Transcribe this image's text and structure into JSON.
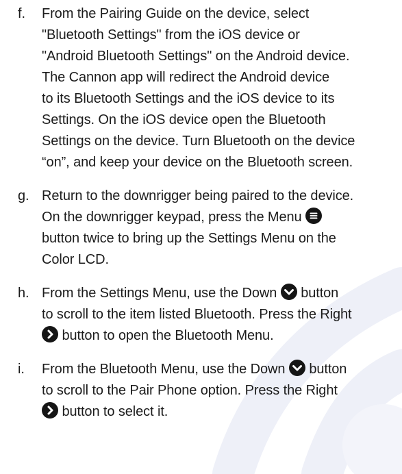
{
  "steps": [
    {
      "letter": "f.",
      "lines": [
        "From the Pairing Guide on the device, select",
        "\"Bluetooth Settings\" from the iOS device or",
        "\"Android Bluetooth Settings\" on the Android device.",
        "The Cannon app will redirect the Android device",
        "to its Bluetooth Settings and the iOS device to its",
        "Settings. On the iOS device open the Bluetooth",
        "Settings on the device. Turn Bluetooth on the device",
        "“on”, and keep your device on the Bluetooth screen."
      ]
    },
    {
      "letter": "g.",
      "line1": "Return to the downrigger being paired to the device.",
      "line2": "On the downrigger keypad, press the Menu",
      "line3": "button twice to bring up the Settings Menu on the",
      "line4": "Color LCD."
    },
    {
      "letter": "h.",
      "line1a": "From the Settings Menu, use the Down",
      "line1b": "button",
      "line2": "to scroll to the item listed Bluetooth. Press the Right",
      "line3": "button to open the Bluetooth Menu."
    },
    {
      "letter": "i.",
      "line1a": "From the Bluetooth Menu, use the Down",
      "line1b": "button",
      "line2": "to scroll to the Pair Phone option. Press the Right",
      "line3": "button to select it."
    }
  ],
  "icons": {
    "menu": "menu-icon",
    "down": "chevron-down-icon",
    "right": "chevron-right-icon"
  },
  "colors": {
    "text": "#1c1c1c",
    "icon_fill": "#151515",
    "watermark": "#eef0f8"
  }
}
